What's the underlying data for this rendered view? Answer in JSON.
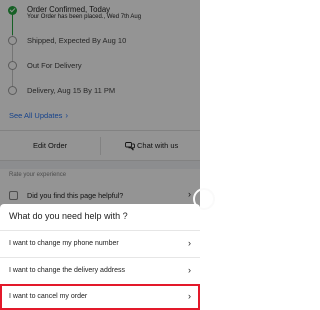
{
  "tracker": {
    "steps": [
      {
        "title": "Order Confirmed, Today",
        "subtitle": "Your Order has been placed., Wed 7th Aug",
        "status": "done"
      },
      {
        "title": "Shipped, Expected By Aug 10",
        "status": "pending"
      },
      {
        "title": "Out For Delivery",
        "status": "pending"
      },
      {
        "title": "Delivery, Aug 15 By 11 PM",
        "status": "pending"
      }
    ],
    "see_all_label": "See All Updates",
    "see_all_chevron": "›"
  },
  "actions": {
    "edit_label": "Edit Order",
    "chat_label": "Chat with us",
    "chat_icon": "chat-bubbles-icon"
  },
  "feedback": {
    "section_label": "Rate your experience",
    "question": "Did you find this page helpful?",
    "chevron": "›"
  },
  "help_sheet": {
    "title": "What do you need help with ?",
    "options": [
      {
        "label": "I want to change my phone number",
        "chevron": "›",
        "selected": false
      },
      {
        "label": "I want to change the delivery address",
        "chevron": "›",
        "selected": false
      },
      {
        "label": "I want to cancel my order",
        "chevron": "›",
        "selected": true
      }
    ]
  },
  "colors": {
    "accent_green": "#26a541",
    "link_blue": "#2874f0",
    "highlight_red": "#e3192a",
    "overlay": "rgba(0,0,0,0.42)"
  }
}
